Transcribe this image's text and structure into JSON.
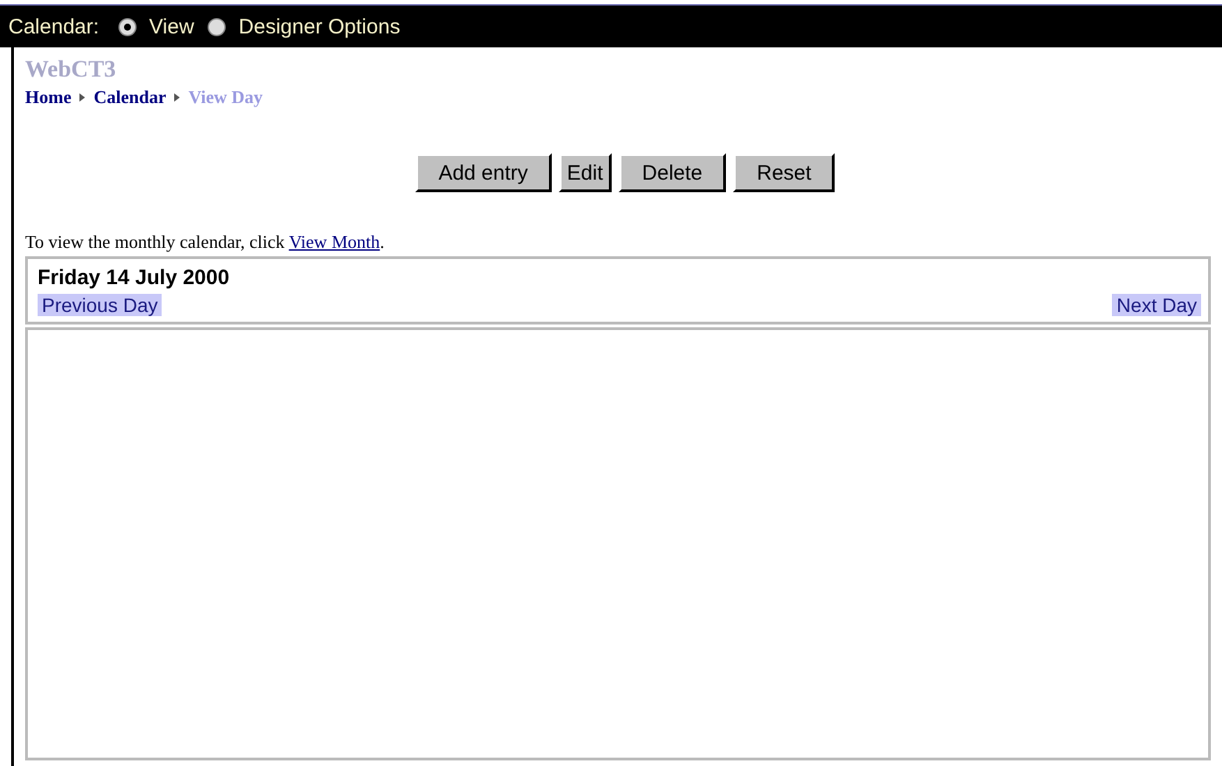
{
  "top_bar": {
    "label": "Calendar:",
    "options": [
      {
        "label": "View",
        "selected": true
      },
      {
        "label": "Designer Options",
        "selected": false
      }
    ]
  },
  "site_title": "WebCT3",
  "breadcrumbs": [
    {
      "label": "Home",
      "current": false
    },
    {
      "label": "Calendar",
      "current": false
    },
    {
      "label": "View Day",
      "current": true
    }
  ],
  "buttons": [
    "Add entry",
    "Edit",
    "Delete",
    "Reset"
  ],
  "instruction": {
    "text": "To view the monthly calendar, click ",
    "link": "View Month",
    "end": "."
  },
  "day_view": {
    "date": "Friday 14 July 2000",
    "previous": "Previous Day",
    "next": "Next Day"
  }
}
